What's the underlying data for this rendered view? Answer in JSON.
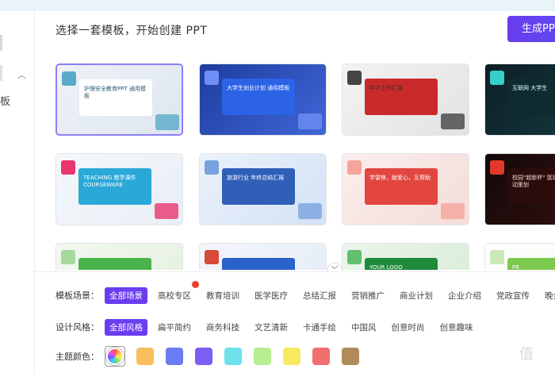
{
  "header": {
    "title": "选择一套模板，开始创建 PPT",
    "create_label": "生成PPT"
  },
  "sidebar": {
    "partial_label": "板"
  },
  "templates": [
    {
      "name": "护理安全教育PPT 通用模板",
      "theme": "light-gray",
      "selected": true
    },
    {
      "name": "大学生创业计划 通用模板",
      "theme": "blue",
      "selected": false
    },
    {
      "name": "年中工作汇报",
      "theme": "red-gray",
      "selected": false
    },
    {
      "name": "互联网 大学生",
      "theme": "dark-teal",
      "selected": false
    },
    {
      "name": "TEACHING 教学课件 COURSEWARE",
      "theme": "colorful",
      "selected": false
    },
    {
      "name": "旅游行业 年终总结汇报",
      "theme": "blue-light",
      "selected": false
    },
    {
      "name": "学雷锋，献爱心，互帮助",
      "theme": "red-light",
      "selected": false
    },
    {
      "name": "校园\"超新杯\" 篮球比赛活动策划",
      "theme": "dark-red",
      "selected": false
    },
    {
      "name": "",
      "theme": "green-light",
      "selected": false
    },
    {
      "name": "",
      "theme": "blue-red",
      "selected": false
    },
    {
      "name": "YOUR LOGO",
      "theme": "green-dark",
      "selected": false
    },
    {
      "name": "PR",
      "theme": "green-white",
      "selected": false
    }
  ],
  "filters": {
    "scene": {
      "label": "模板场景：",
      "options": [
        "全部场景",
        "高校专区",
        "教育培训",
        "医学医疗",
        "总结汇报",
        "营销推广",
        "商业计划",
        "企业介绍",
        "党政宣传",
        "晚会"
      ]
    },
    "style": {
      "label": "设计风格：",
      "options": [
        "全部风格",
        "扁平简约",
        "商务科技",
        "文艺清新",
        "卡通手绘",
        "中国风",
        "创意时尚",
        "创意趣味"
      ]
    },
    "color": {
      "label": "主题颜色：",
      "swatches": [
        "all",
        "#f9bf5e",
        "#6b7cf2",
        "#7d5ef2",
        "#6ee1ea",
        "#b8ee93",
        "#f7ea5e",
        "#f07070",
        "#b08a5a"
      ]
    }
  },
  "watermark": "值"
}
